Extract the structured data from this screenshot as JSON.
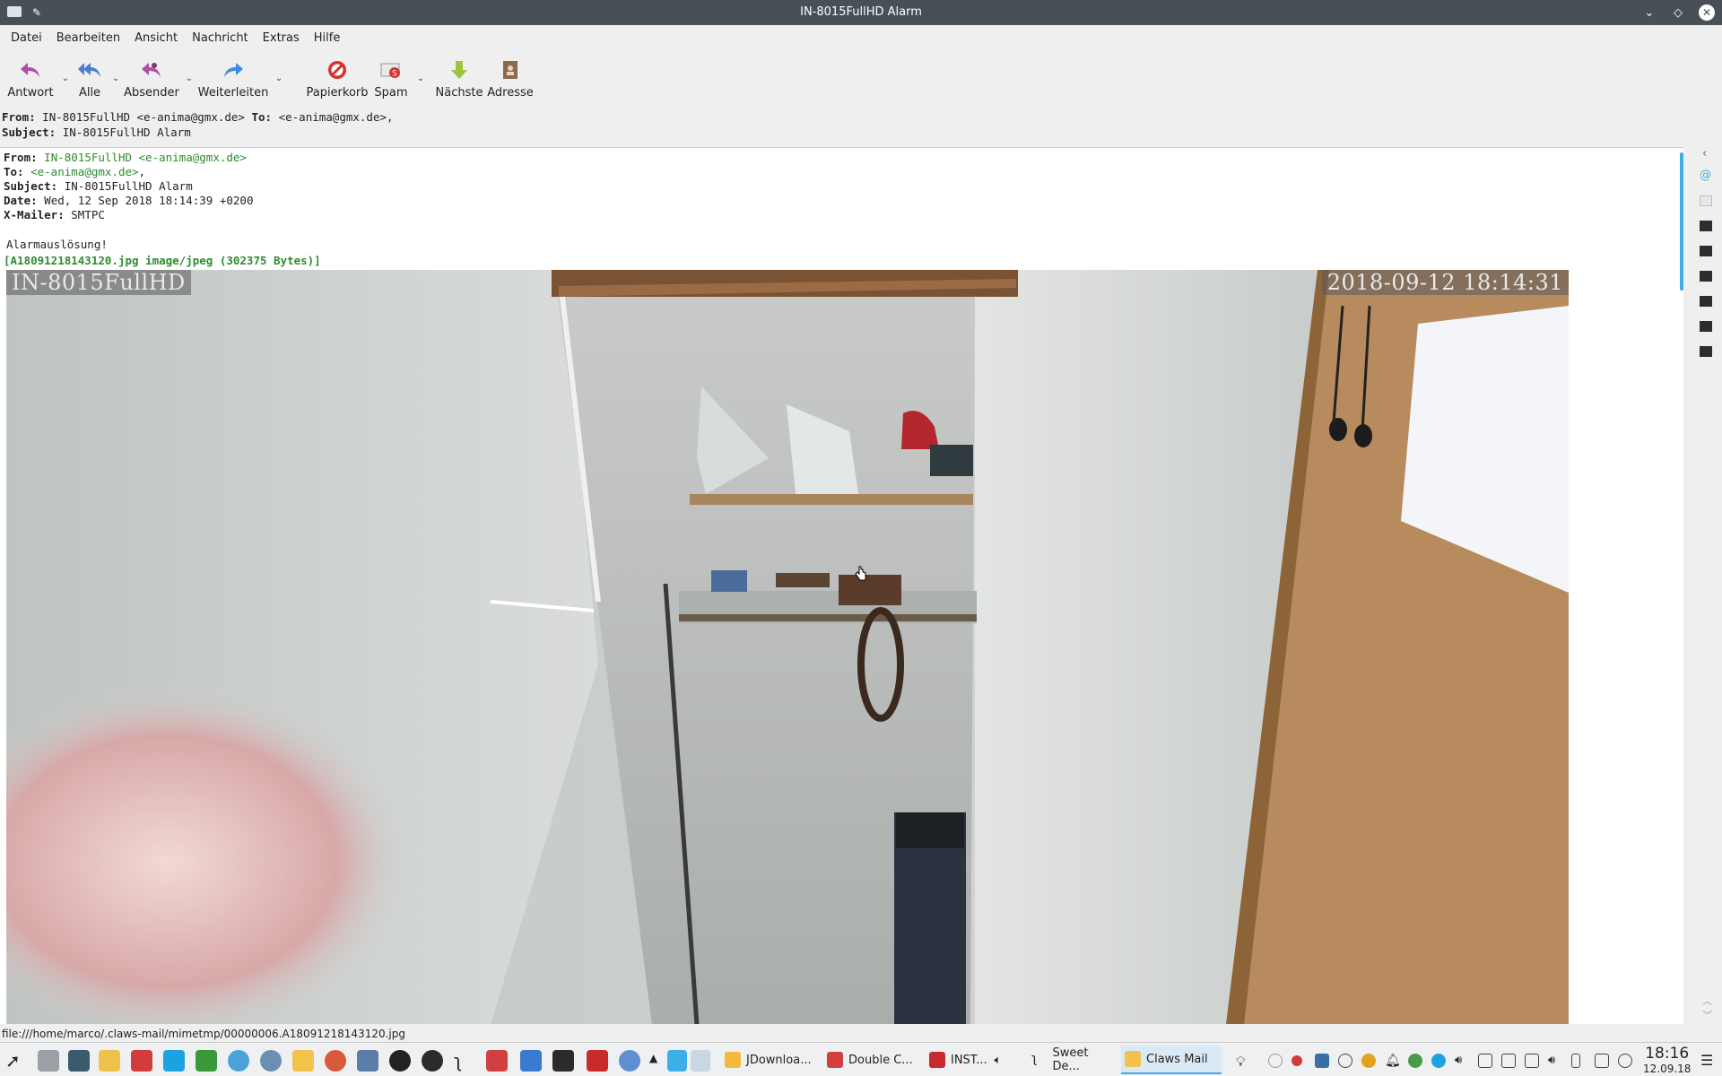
{
  "window": {
    "title": "IN-8015FullHD Alarm"
  },
  "menu": [
    "Datei",
    "Bearbeiten",
    "Ansicht",
    "Nachricht",
    "Extras",
    "Hilfe"
  ],
  "toolbar": {
    "reply": "Antwort",
    "reply_all": "Alle",
    "sender": "Absender",
    "forward": "Weiterleiten",
    "trash": "Papierkorb",
    "spam": "Spam",
    "next": "Nächste",
    "address": "Adresse"
  },
  "summary": {
    "from_label": "From:",
    "from_value": "IN-8015FullHD <e-anima@gmx.de>",
    "to_label": "To:",
    "to_value": "<e-anima@gmx.de>,",
    "subject_label": "Subject:",
    "subject_value": "IN-8015FullHD Alarm"
  },
  "headers": {
    "from_label": "From:",
    "from_value": "IN-8015FullHD <e-anima@gmx.de>",
    "to_label": "To:",
    "to_value": "<e-anima@gmx.de>",
    "to_suffix": ",",
    "subject_label": "Subject:",
    "subject_value": "IN-8015FullHD Alarm",
    "date_label": "Date:",
    "date_value": "Wed, 12 Sep 2018 18:14:39 +0200",
    "xmailer_label": "X-Mailer:",
    "xmailer_value": "SMTPC"
  },
  "body": {
    "text": "Alarmauslösung!"
  },
  "attachment": {
    "label": "[A18091218143120.jpg  image/jpeg (302375 Bytes)]"
  },
  "camera": {
    "name_overlay": "IN-8015FullHD",
    "timestamp_overlay": "2018-09-12 18:14:31"
  },
  "statusbar": {
    "text": "file:///home/marco/.claws-mail/mimetmp/00000006.A18091218143120.jpg"
  },
  "taskbar": {
    "tasks": [
      "JDownloa...",
      "Double C...",
      "INST...",
      "Sweet De...",
      "Claws Mail"
    ],
    "time": "18:16",
    "date": "12.09.18"
  },
  "colors": {
    "titlebar": "#475057",
    "accent": "#3daee9",
    "link_green": "#2e8b2e"
  }
}
